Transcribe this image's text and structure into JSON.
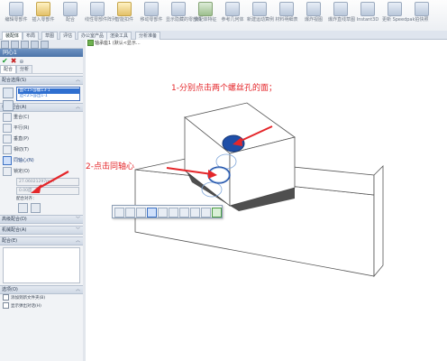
{
  "ribbon": {
    "buttons": [
      {
        "label": "编辑零部件",
        "icon": "edit-component-icon",
        "tone": "b"
      },
      {
        "label": "插入零部件",
        "icon": "insert-component-icon",
        "tone": "y"
      },
      {
        "label": "配合",
        "icon": "mate-icon",
        "tone": "b"
      },
      {
        "label": "线性零部件阵列",
        "icon": "linear-pattern-icon",
        "tone": "b"
      },
      {
        "label": "智能扣件",
        "icon": "smart-fastener-icon",
        "tone": "y"
      },
      {
        "label": "移动零部件",
        "icon": "move-component-icon",
        "tone": "b"
      },
      {
        "label": "显示隐藏的零部件",
        "icon": "show-hidden-icon",
        "tone": "b"
      },
      {
        "label": "装配体特征",
        "icon": "assembly-feature-icon",
        "tone": "g"
      },
      {
        "label": "参考几何体",
        "icon": "ref-geometry-icon",
        "tone": "b"
      },
      {
        "label": "新建运动算例",
        "icon": "motion-study-icon",
        "tone": "b"
      },
      {
        "label": "材料明细表",
        "icon": "bom-icon",
        "tone": "b"
      },
      {
        "label": "爆炸视图",
        "icon": "explode-icon",
        "tone": "b"
      },
      {
        "label": "爆炸直线草图",
        "icon": "explode-line-icon",
        "tone": "b"
      },
      {
        "label": "Instant3D",
        "icon": "instant3d-icon",
        "tone": "b"
      },
      {
        "label": "更新 Speedpak",
        "icon": "speedpak-icon",
        "tone": "b"
      },
      {
        "label": "拍快照",
        "icon": "snapshot-icon",
        "tone": "b"
      }
    ]
  },
  "tabs": [
    "装配体",
    "布局",
    "草图",
    "评估",
    "办公室产品",
    "渲染工具",
    "分析准备"
  ],
  "panel": {
    "title": "同心1",
    "subtabs": [
      "配合",
      "分析"
    ],
    "mate_selection": {
      "header": "配合选择(S)",
      "items": [
        "面<1>@螺13-1",
        "边<2>@出1-1"
      ]
    },
    "standard_mates": {
      "header": "标准配合(A)",
      "items": [
        {
          "label": "重合(C)",
          "icon": "coincident-icon"
        },
        {
          "label": "平行(R)",
          "icon": "parallel-icon"
        },
        {
          "label": "垂直(P)",
          "icon": "perpendicular-icon"
        },
        {
          "label": "相切(T)",
          "icon": "tangent-icon"
        },
        {
          "label": "同轴心(N)",
          "icon": "concentric-icon",
          "selected": true
        },
        {
          "label": "锁定(O)",
          "icon": "lock-icon"
        }
      ],
      "distance_value": "27.06021297mm",
      "angle_value": "0.00度",
      "alignment_label": "配合对齐："
    },
    "advanced_header": "高级配合(D)",
    "mechanical_header": "机械配合(A)",
    "mates_header": "配合(E)",
    "options_header": "选项(O)",
    "options": [
      "添加到新文件夹(B)",
      "显示弹出对话(H)"
    ]
  },
  "viewport": {
    "breadcrumb": "轴承座1 (默认<显示...",
    "annotations": {
      "step1": "1-分别点击两个螺丝孔的面；",
      "step2": "2-点击同轴心"
    },
    "annotation_color": "#e4262a"
  }
}
